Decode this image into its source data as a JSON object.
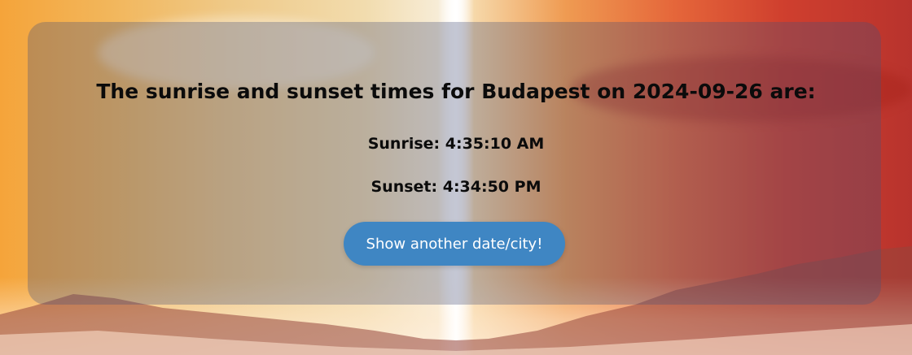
{
  "heading": "The sunrise and sunset times for Budapest on 2024-09-26 are:",
  "sunrise": "Sunrise: 4:35:10 AM",
  "sunset": "Sunset: 4:34:50 PM",
  "button_label": "Show another date/city!",
  "colors": {
    "button": "#3f86c3",
    "panel_overlay": "rgba(70, 80, 120, 0.32)",
    "text": "#0b0b0b"
  }
}
